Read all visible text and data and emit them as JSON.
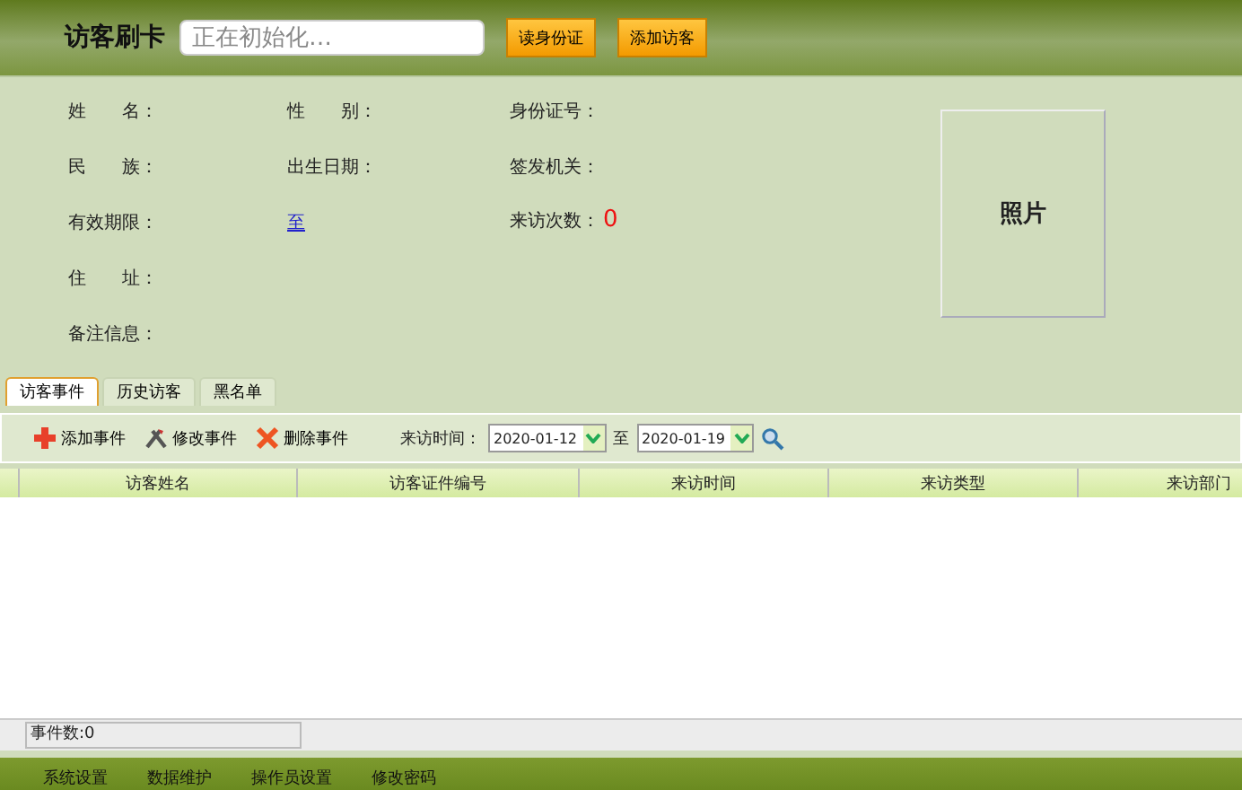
{
  "header": {
    "title": "访客刷卡",
    "card_field": {
      "value": "正在初始化…"
    },
    "buttons": [
      "读身份证",
      "添加访客"
    ]
  },
  "info": {
    "rows": [
      [
        {
          "label": "姓　　名："
        },
        {
          "label": "性　　别："
        },
        {
          "label": "身份证号："
        }
      ],
      [
        {
          "label": "民　　族："
        },
        {
          "label": "出生日期："
        },
        {
          "label": "签发机关："
        }
      ]
    ],
    "validity": {
      "label": "有效期限：",
      "link": "至"
    },
    "visit_count": {
      "label": "来访次数：",
      "value": "0"
    },
    "address": "住　　址：",
    "notes": "备注信息：",
    "photo": "照片"
  },
  "tabs": [
    {
      "label": "访客事件",
      "selected": true
    },
    {
      "label": "历史访客",
      "selected": false
    },
    {
      "label": "黑名单",
      "selected": false
    }
  ],
  "toolbar": {
    "actions": [
      {
        "label": "添加事件",
        "kind": "add"
      },
      {
        "label": "修改事件",
        "kind": "edit"
      },
      {
        "label": "删除事件",
        "kind": "delete"
      }
    ],
    "time_label": "来访时间：",
    "from": "2020-01-12",
    "to_label": "至",
    "to": "2020-01-19"
  },
  "table": {
    "columns": [
      "访客姓名",
      "访客证件编号",
      "来访时间",
      "来访类型",
      "来访部门"
    ]
  },
  "status_bar": "事件数:0",
  "menu": [
    "系统设置",
    "数据维护",
    "操作员设置",
    "修改密码"
  ]
}
